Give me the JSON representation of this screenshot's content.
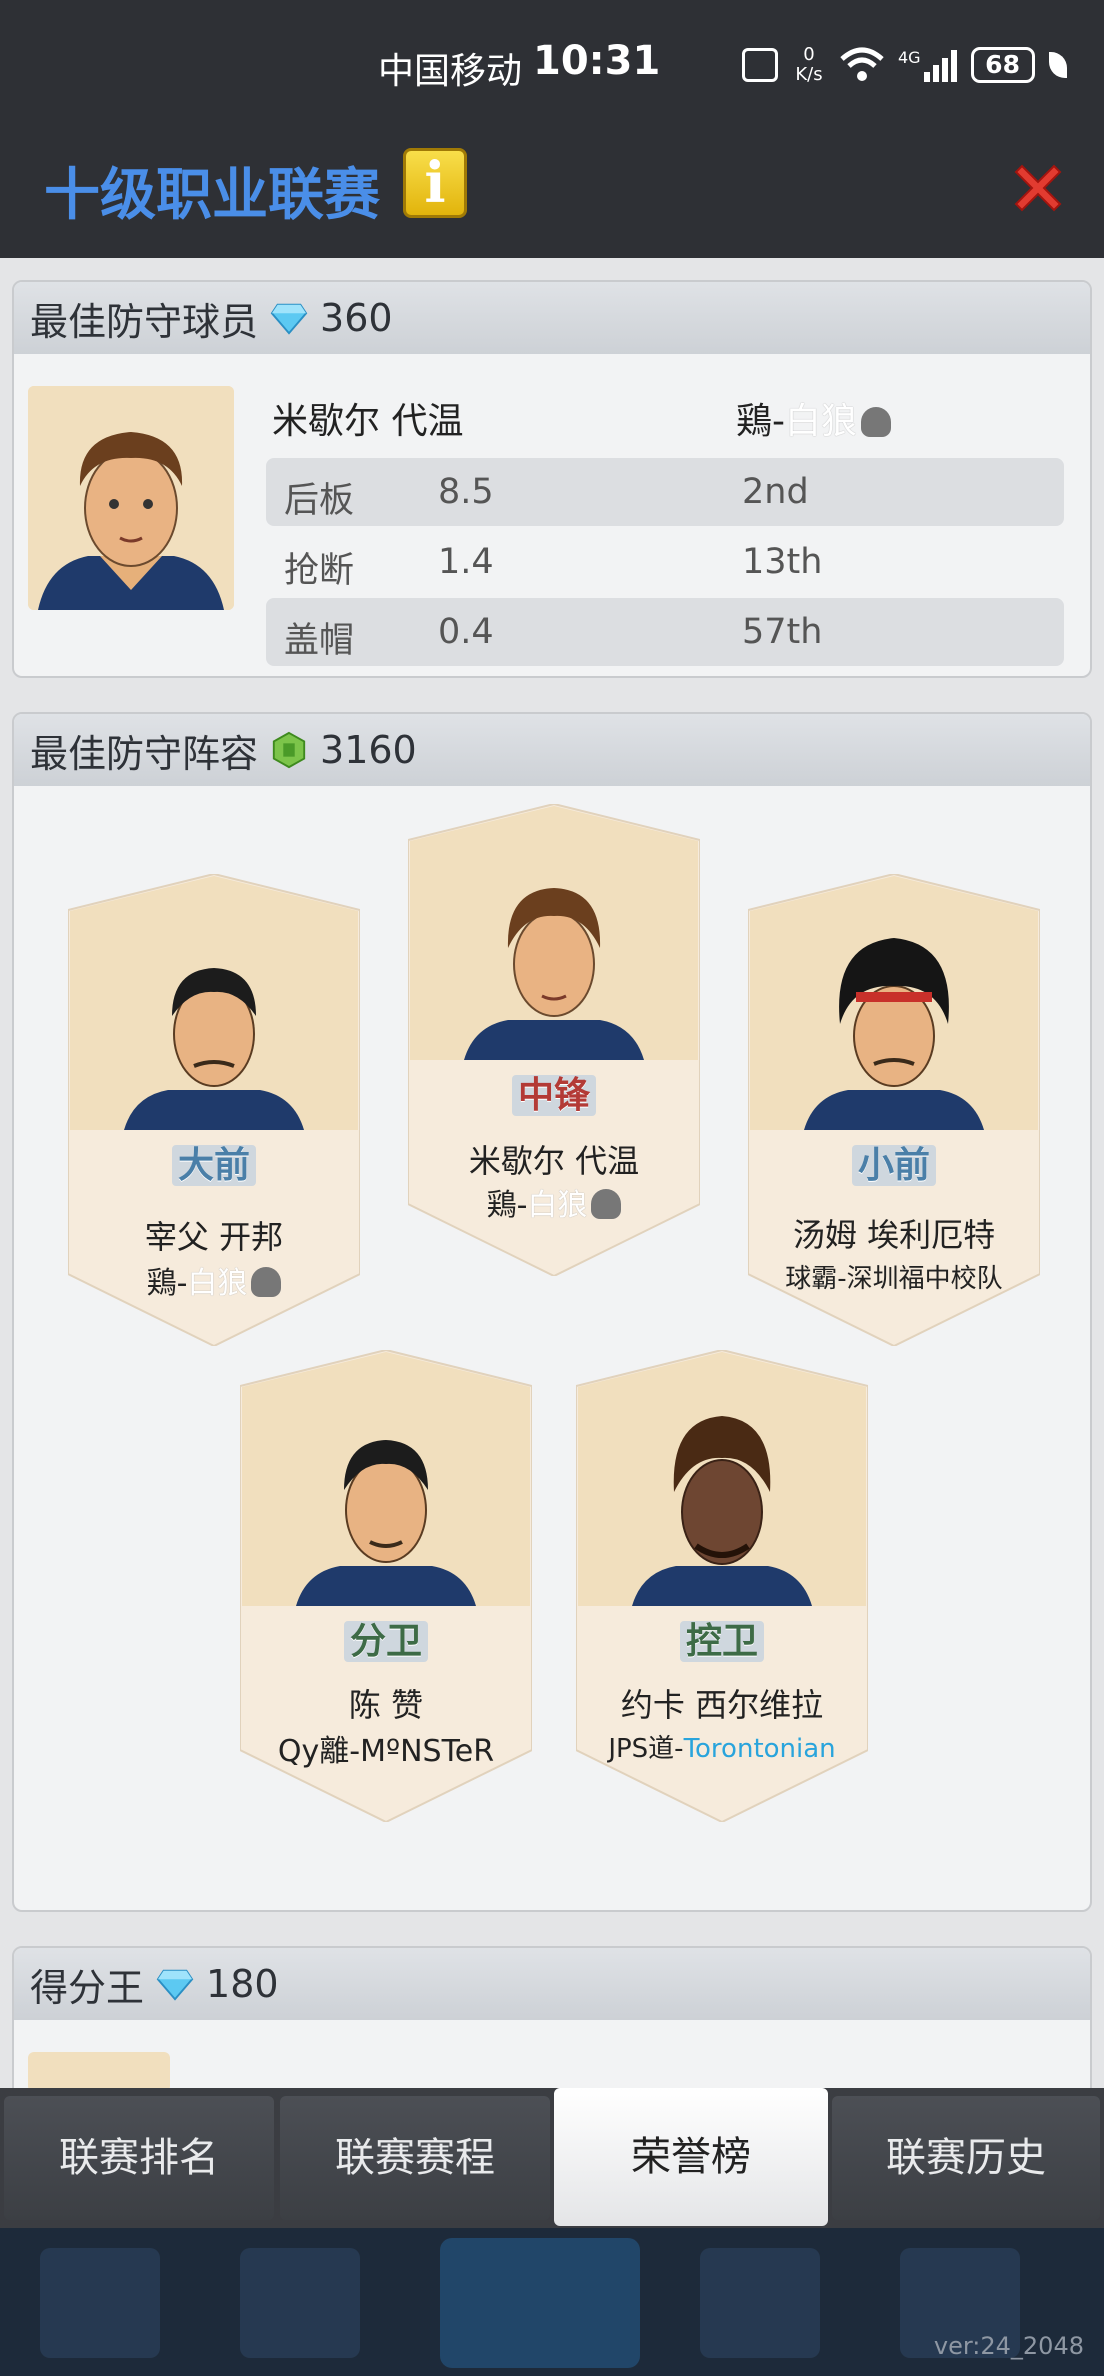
{
  "status_bar": {
    "carrier": "中国移动",
    "time": "10:31",
    "net_speed_value": "0",
    "net_speed_unit": "K/s",
    "network": "4G",
    "battery": "68"
  },
  "header": {
    "title": "十级职业联赛",
    "info_label": "i"
  },
  "best_defender": {
    "title": "最佳防守球员",
    "reward": "360",
    "player_name": "米歇尔 代温",
    "team_prefix": "鶏-",
    "team_name": "白狼",
    "stats": [
      {
        "label": "后板",
        "value": "8.5",
        "rank": "2nd"
      },
      {
        "label": "抢断",
        "value": "1.4",
        "rank": "13th"
      },
      {
        "label": "盖帽",
        "value": "0.4",
        "rank": "57th"
      }
    ]
  },
  "best_lineup": {
    "title": "最佳防守阵容",
    "reward": "3160",
    "cards": [
      {
        "pos": "大前",
        "name": "宰父 开邦",
        "team_prefix": "鶏-",
        "team_name": "白狼"
      },
      {
        "pos": "中锋",
        "name": "米歇尔 代温",
        "team_prefix": "鶏-",
        "team_name": "白狼"
      },
      {
        "pos": "小前",
        "name": "汤姆 埃利厄特",
        "team": "球霸-深圳福中校队"
      },
      {
        "pos": "分卫",
        "name": "陈 赞",
        "team": "Qy離-MºNSTeR"
      },
      {
        "pos": "控卫",
        "name": "约卡 西尔维拉",
        "team_prefix": "JPS道-",
        "team_name": "Torontonian"
      }
    ]
  },
  "scoring_leader": {
    "title": "得分王",
    "reward": "180"
  },
  "tabs": [
    "联赛排名",
    "联赛赛程",
    "荣誉榜",
    "联赛历史"
  ],
  "active_tab": "荣誉榜",
  "version": "ver:24_2048",
  "colors": {
    "title_blue": "#4a8ee8",
    "header_bg": "#2e3035",
    "card_bg": "#f1dfbe"
  }
}
